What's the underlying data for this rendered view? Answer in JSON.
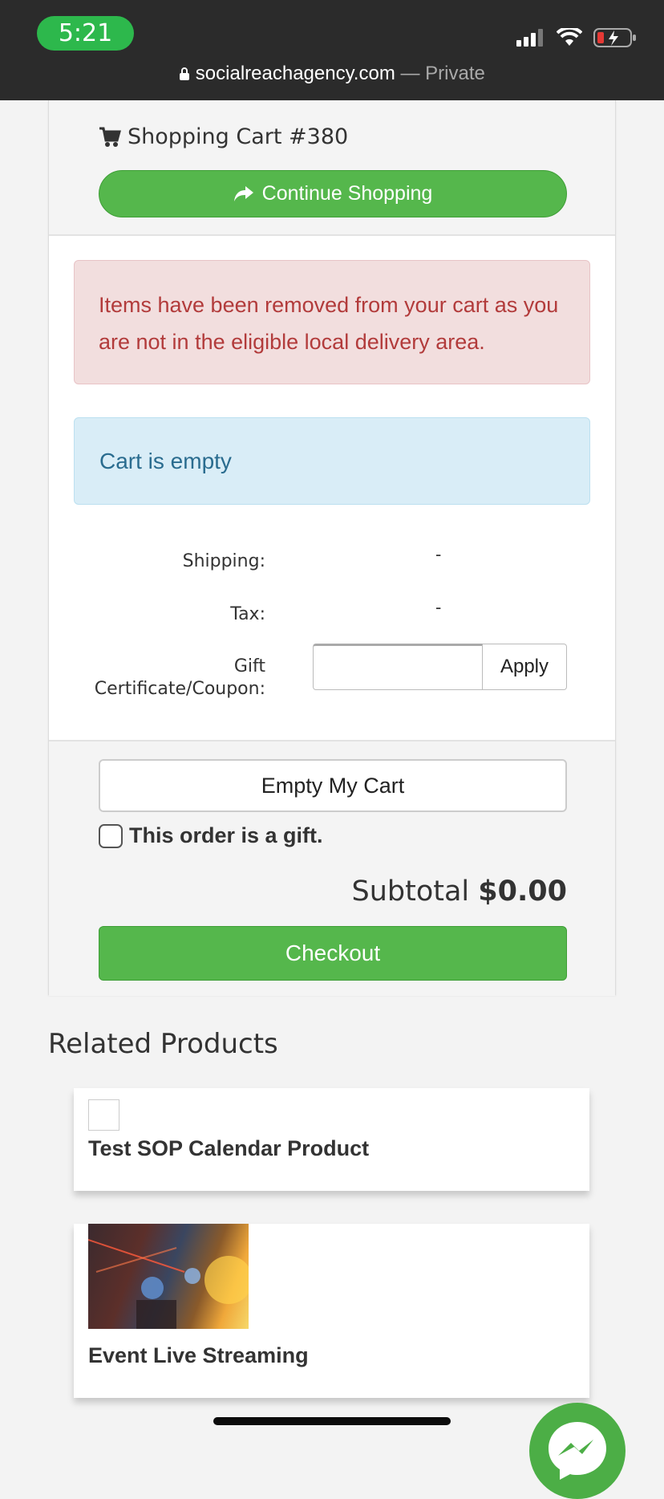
{
  "status_bar": {
    "time": "5:21",
    "url": "socialreachagency.com",
    "url_suffix": "— Private"
  },
  "cart": {
    "title": "Shopping Cart #380",
    "continue_label": "Continue Shopping",
    "alert_message": "Items have been removed from your cart as you are not in the eligible local delivery area.",
    "info_message": "Cart is empty",
    "shipping_label": "Shipping:",
    "shipping_value": "-",
    "tax_label": "Tax:",
    "tax_value": "-",
    "coupon_label_1": "Gift",
    "coupon_label_2": "Certificate/Coupon:",
    "coupon_value": "",
    "apply_label": "Apply",
    "empty_label": "Empty My Cart",
    "gift_label": "This order is a gift.",
    "gift_checked": false,
    "subtotal_label": "Subtotal",
    "subtotal_value": "$0.00",
    "checkout_label": "Checkout"
  },
  "related": {
    "title": "Related Products",
    "products": [
      {
        "name": "Test SOP Calendar Product"
      },
      {
        "name": "Event Live Streaming"
      }
    ]
  },
  "colors": {
    "primary_green": "#55b74c",
    "danger_text": "#b23b3b",
    "info_text": "#2a6c8f",
    "messenger": "#4cae46"
  }
}
